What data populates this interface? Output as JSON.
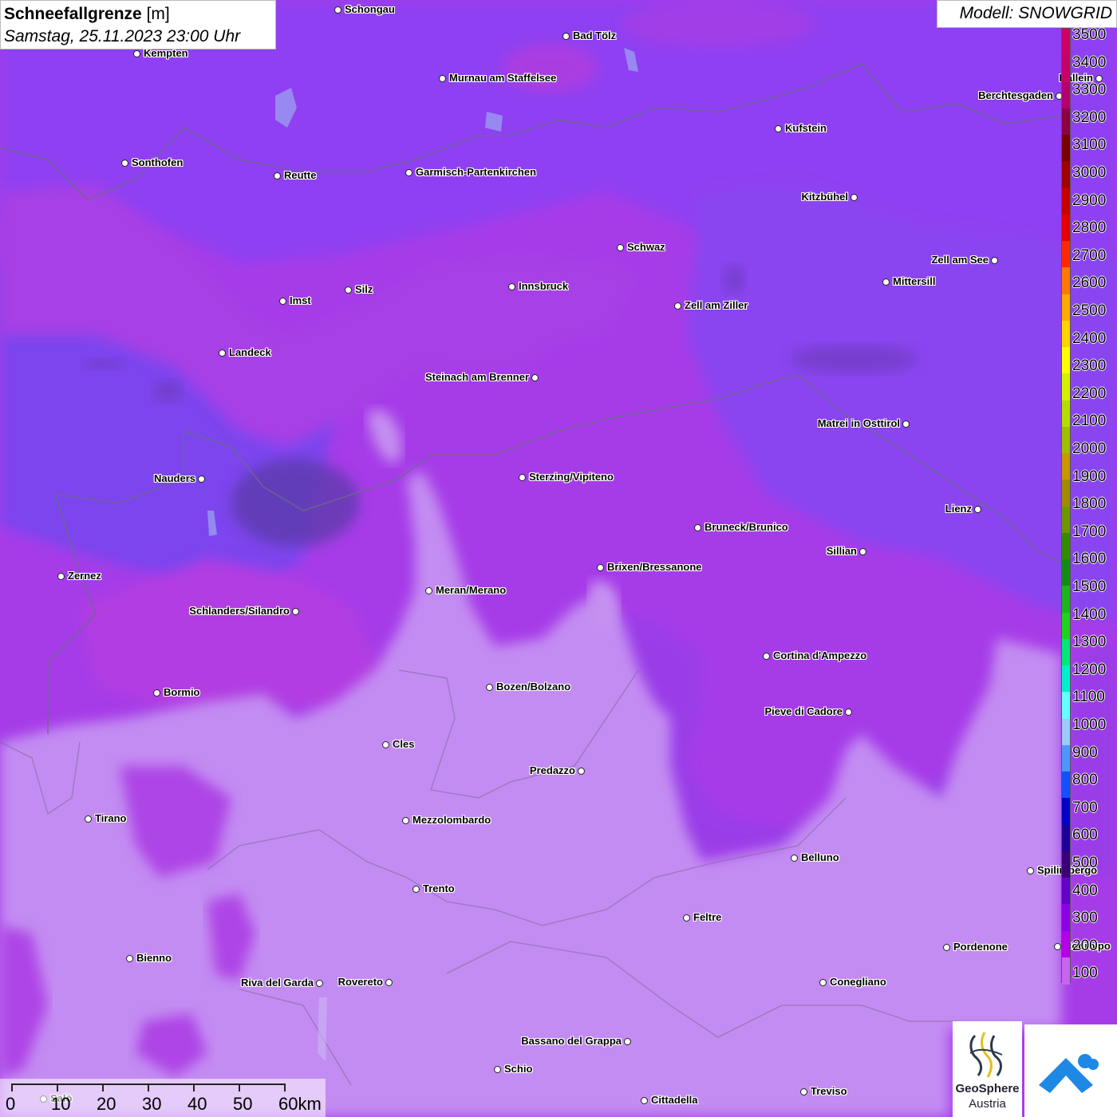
{
  "title": {
    "param_bold": "Schneefallgrenze",
    "param_unit": " [m]",
    "datetime": "Samstag, 25.11.2023 23:00 Uhr"
  },
  "model_label": "Modell: SNOWGRID",
  "legend": {
    "ticks": [
      "3500",
      "3400",
      "3300",
      "3200",
      "3100",
      "3000",
      "2900",
      "2800",
      "2700",
      "2600",
      "2500",
      "2400",
      "2300",
      "2200",
      "2100",
      "2000",
      "1900",
      "1800",
      "1700",
      "1600",
      "1500",
      "1400",
      "1300",
      "1200",
      "1100",
      "1000",
      "900",
      "800",
      "700",
      "600",
      "500",
      "400",
      "300",
      "200",
      "100"
    ],
    "colors": [
      "#cc0066",
      "#c8006a",
      "#b4006e",
      "#8c0044",
      "#780000",
      "#a00000",
      "#c80000",
      "#e60000",
      "#ff2800",
      "#ff7800",
      "#ffaa00",
      "#ffd200",
      "#ffff00",
      "#d2f000",
      "#b4dc00",
      "#a0be00",
      "#c89600",
      "#a08c00",
      "#6e9600",
      "#328c00",
      "#148c14",
      "#1eb41e",
      "#1ed21e",
      "#00e878",
      "#00f0c8",
      "#64ffff",
      "#a0c8ff",
      "#5096ff",
      "#1450ff",
      "#0000c8",
      "#1e0096",
      "#3c0078",
      "#6400c8",
      "#8c00e6",
      "#b400e6",
      "#c864f0"
    ]
  },
  "cities": [
    {
      "name": "Schongau"
    },
    {
      "name": "Bad Tölz"
    },
    {
      "name": "Kempten"
    },
    {
      "name": "Murnau am Staffelsee"
    },
    {
      "name": "Hallein"
    },
    {
      "name": "Berchtesgaden"
    },
    {
      "name": "Kufstein"
    },
    {
      "name": "Sonthofen"
    },
    {
      "name": "Reutte"
    },
    {
      "name": "Garmisch-Partenkirchen"
    },
    {
      "name": "Kitzbühel"
    },
    {
      "name": "Schwaz"
    },
    {
      "name": "Zell am See"
    },
    {
      "name": "Innsbruck"
    },
    {
      "name": "Imst"
    },
    {
      "name": "Silz"
    },
    {
      "name": "Mittersill"
    },
    {
      "name": "Zell am Ziller"
    },
    {
      "name": "Landeck"
    },
    {
      "name": "Steinach am Brenner"
    },
    {
      "name": "Matrei in Osttirol"
    },
    {
      "name": "Nauders"
    },
    {
      "name": "Sterzing/Vipiteno"
    },
    {
      "name": "Lienz"
    },
    {
      "name": "Bruneck/Brunico"
    },
    {
      "name": "Sillian"
    },
    {
      "name": "Zernez"
    },
    {
      "name": "Brixen/Bressanone"
    },
    {
      "name": "Meran/Merano"
    },
    {
      "name": "Schlanders/Silandro"
    },
    {
      "name": "Cortina d'Ampezzo"
    },
    {
      "name": "Bozen/Bolzano"
    },
    {
      "name": "Bormio"
    },
    {
      "name": "Pieve di Cadore"
    },
    {
      "name": "Cles"
    },
    {
      "name": "Predazzo"
    },
    {
      "name": "Tirano"
    },
    {
      "name": "Mezzolombardo"
    },
    {
      "name": "Belluno"
    },
    {
      "name": "Spilimbergo"
    },
    {
      "name": "Trento"
    },
    {
      "name": "Feltre"
    },
    {
      "name": "Pordenone"
    },
    {
      "name": "Codroipo"
    },
    {
      "name": "Bienno"
    },
    {
      "name": "Riva del Garda"
    },
    {
      "name": "Rovereto"
    },
    {
      "name": "Conegliano"
    },
    {
      "name": "Bassano del Grappa"
    },
    {
      "name": "Schio"
    },
    {
      "name": "Treviso"
    },
    {
      "name": "Cittadella"
    },
    {
      "name": "Salò"
    }
  ],
  "scalebar": {
    "labels": [
      "0",
      "10",
      "20",
      "30",
      "40",
      "50",
      "60km"
    ]
  },
  "logo": {
    "line1": "GeoSphere",
    "line2": "Austria"
  }
}
